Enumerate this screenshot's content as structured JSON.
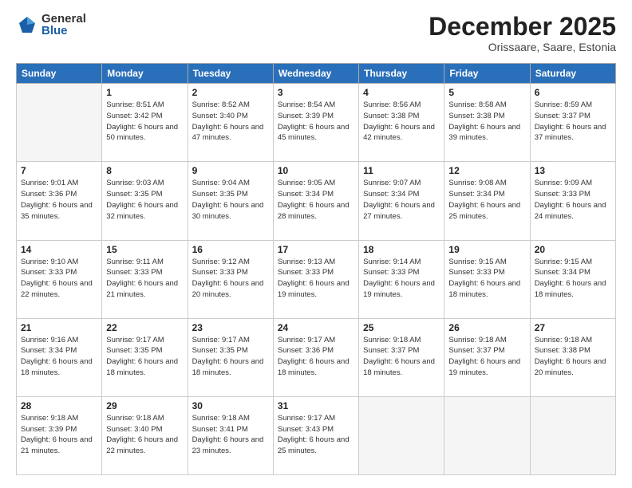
{
  "header": {
    "logo_general": "General",
    "logo_blue": "Blue",
    "month": "December 2025",
    "location": "Orissaare, Saare, Estonia"
  },
  "weekdays": [
    "Sunday",
    "Monday",
    "Tuesday",
    "Wednesday",
    "Thursday",
    "Friday",
    "Saturday"
  ],
  "weeks": [
    [
      {
        "day": "",
        "sunrise": "",
        "sunset": "",
        "daylight": ""
      },
      {
        "day": "1",
        "sunrise": "Sunrise: 8:51 AM",
        "sunset": "Sunset: 3:42 PM",
        "daylight": "Daylight: 6 hours and 50 minutes."
      },
      {
        "day": "2",
        "sunrise": "Sunrise: 8:52 AM",
        "sunset": "Sunset: 3:40 PM",
        "daylight": "Daylight: 6 hours and 47 minutes."
      },
      {
        "day": "3",
        "sunrise": "Sunrise: 8:54 AM",
        "sunset": "Sunset: 3:39 PM",
        "daylight": "Daylight: 6 hours and 45 minutes."
      },
      {
        "day": "4",
        "sunrise": "Sunrise: 8:56 AM",
        "sunset": "Sunset: 3:38 PM",
        "daylight": "Daylight: 6 hours and 42 minutes."
      },
      {
        "day": "5",
        "sunrise": "Sunrise: 8:58 AM",
        "sunset": "Sunset: 3:38 PM",
        "daylight": "Daylight: 6 hours and 39 minutes."
      },
      {
        "day": "6",
        "sunrise": "Sunrise: 8:59 AM",
        "sunset": "Sunset: 3:37 PM",
        "daylight": "Daylight: 6 hours and 37 minutes."
      }
    ],
    [
      {
        "day": "7",
        "sunrise": "Sunrise: 9:01 AM",
        "sunset": "Sunset: 3:36 PM",
        "daylight": "Daylight: 6 hours and 35 minutes."
      },
      {
        "day": "8",
        "sunrise": "Sunrise: 9:03 AM",
        "sunset": "Sunset: 3:35 PM",
        "daylight": "Daylight: 6 hours and 32 minutes."
      },
      {
        "day": "9",
        "sunrise": "Sunrise: 9:04 AM",
        "sunset": "Sunset: 3:35 PM",
        "daylight": "Daylight: 6 hours and 30 minutes."
      },
      {
        "day": "10",
        "sunrise": "Sunrise: 9:05 AM",
        "sunset": "Sunset: 3:34 PM",
        "daylight": "Daylight: 6 hours and 28 minutes."
      },
      {
        "day": "11",
        "sunrise": "Sunrise: 9:07 AM",
        "sunset": "Sunset: 3:34 PM",
        "daylight": "Daylight: 6 hours and 27 minutes."
      },
      {
        "day": "12",
        "sunrise": "Sunrise: 9:08 AM",
        "sunset": "Sunset: 3:34 PM",
        "daylight": "Daylight: 6 hours and 25 minutes."
      },
      {
        "day": "13",
        "sunrise": "Sunrise: 9:09 AM",
        "sunset": "Sunset: 3:33 PM",
        "daylight": "Daylight: 6 hours and 24 minutes."
      }
    ],
    [
      {
        "day": "14",
        "sunrise": "Sunrise: 9:10 AM",
        "sunset": "Sunset: 3:33 PM",
        "daylight": "Daylight: 6 hours and 22 minutes."
      },
      {
        "day": "15",
        "sunrise": "Sunrise: 9:11 AM",
        "sunset": "Sunset: 3:33 PM",
        "daylight": "Daylight: 6 hours and 21 minutes."
      },
      {
        "day": "16",
        "sunrise": "Sunrise: 9:12 AM",
        "sunset": "Sunset: 3:33 PM",
        "daylight": "Daylight: 6 hours and 20 minutes."
      },
      {
        "day": "17",
        "sunrise": "Sunrise: 9:13 AM",
        "sunset": "Sunset: 3:33 PM",
        "daylight": "Daylight: 6 hours and 19 minutes."
      },
      {
        "day": "18",
        "sunrise": "Sunrise: 9:14 AM",
        "sunset": "Sunset: 3:33 PM",
        "daylight": "Daylight: 6 hours and 19 minutes."
      },
      {
        "day": "19",
        "sunrise": "Sunrise: 9:15 AM",
        "sunset": "Sunset: 3:33 PM",
        "daylight": "Daylight: 6 hours and 18 minutes."
      },
      {
        "day": "20",
        "sunrise": "Sunrise: 9:15 AM",
        "sunset": "Sunset: 3:34 PM",
        "daylight": "Daylight: 6 hours and 18 minutes."
      }
    ],
    [
      {
        "day": "21",
        "sunrise": "Sunrise: 9:16 AM",
        "sunset": "Sunset: 3:34 PM",
        "daylight": "Daylight: 6 hours and 18 minutes."
      },
      {
        "day": "22",
        "sunrise": "Sunrise: 9:17 AM",
        "sunset": "Sunset: 3:35 PM",
        "daylight": "Daylight: 6 hours and 18 minutes."
      },
      {
        "day": "23",
        "sunrise": "Sunrise: 9:17 AM",
        "sunset": "Sunset: 3:35 PM",
        "daylight": "Daylight: 6 hours and 18 minutes."
      },
      {
        "day": "24",
        "sunrise": "Sunrise: 9:17 AM",
        "sunset": "Sunset: 3:36 PM",
        "daylight": "Daylight: 6 hours and 18 minutes."
      },
      {
        "day": "25",
        "sunrise": "Sunrise: 9:18 AM",
        "sunset": "Sunset: 3:37 PM",
        "daylight": "Daylight: 6 hours and 18 minutes."
      },
      {
        "day": "26",
        "sunrise": "Sunrise: 9:18 AM",
        "sunset": "Sunset: 3:37 PM",
        "daylight": "Daylight: 6 hours and 19 minutes."
      },
      {
        "day": "27",
        "sunrise": "Sunrise: 9:18 AM",
        "sunset": "Sunset: 3:38 PM",
        "daylight": "Daylight: 6 hours and 20 minutes."
      }
    ],
    [
      {
        "day": "28",
        "sunrise": "Sunrise: 9:18 AM",
        "sunset": "Sunset: 3:39 PM",
        "daylight": "Daylight: 6 hours and 21 minutes."
      },
      {
        "day": "29",
        "sunrise": "Sunrise: 9:18 AM",
        "sunset": "Sunset: 3:40 PM",
        "daylight": "Daylight: 6 hours and 22 minutes."
      },
      {
        "day": "30",
        "sunrise": "Sunrise: 9:18 AM",
        "sunset": "Sunset: 3:41 PM",
        "daylight": "Daylight: 6 hours and 23 minutes."
      },
      {
        "day": "31",
        "sunrise": "Sunrise: 9:17 AM",
        "sunset": "Sunset: 3:43 PM",
        "daylight": "Daylight: 6 hours and 25 minutes."
      },
      {
        "day": "",
        "sunrise": "",
        "sunset": "",
        "daylight": ""
      },
      {
        "day": "",
        "sunrise": "",
        "sunset": "",
        "daylight": ""
      },
      {
        "day": "",
        "sunrise": "",
        "sunset": "",
        "daylight": ""
      }
    ]
  ]
}
